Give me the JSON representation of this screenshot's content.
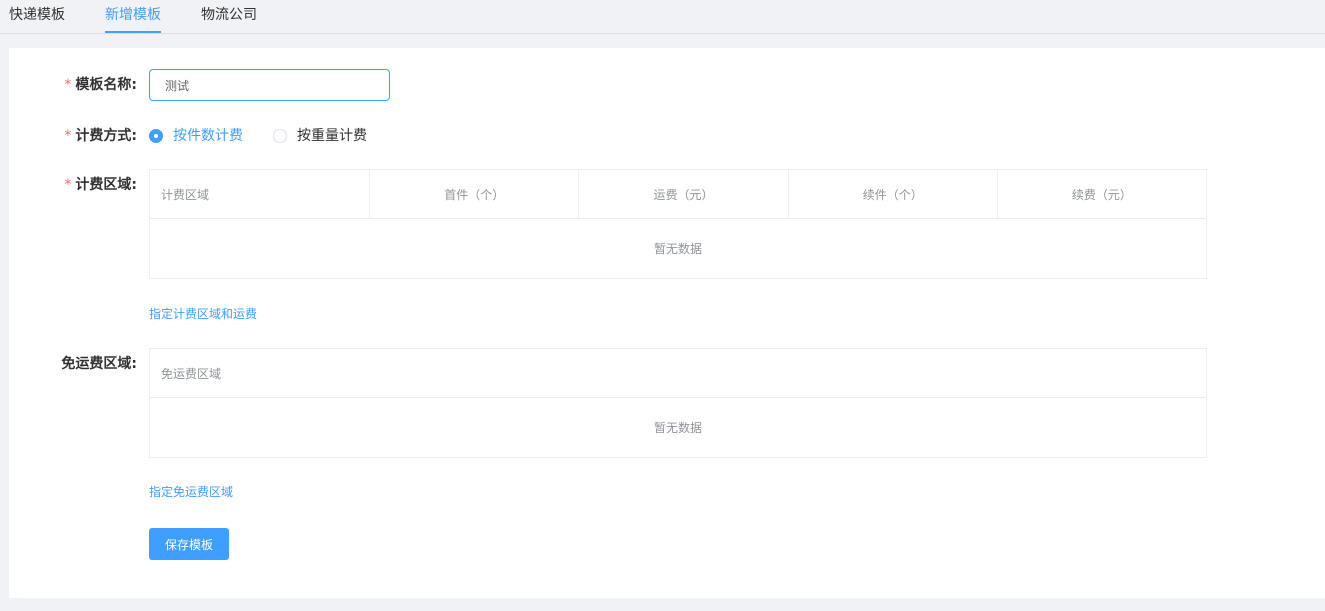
{
  "tabs": [
    {
      "label": "快递模板",
      "active": false
    },
    {
      "label": "新增模板",
      "active": true
    },
    {
      "label": "物流公司",
      "active": false
    }
  ],
  "form": {
    "required_mark": "*",
    "name_label": "模板名称:",
    "name_value": "测试",
    "method_label": "计费方式:",
    "method_options": [
      {
        "label": "按件数计费",
        "checked": true
      },
      {
        "label": "按重量计费",
        "checked": false
      }
    ],
    "area_label": "计费区域:",
    "area_table": {
      "columns": [
        "计费区域",
        "首件（个）",
        "运费（元）",
        "续件（个）",
        "续费（元）"
      ],
      "empty_text": "暂无数据"
    },
    "area_link": "指定计费区域和运费",
    "free_label": "免运费区域:",
    "free_table": {
      "columns": [
        "免运费区域"
      ],
      "empty_text": "暂无数据"
    },
    "free_link": "指定免运费区域",
    "save_label": "保存模板"
  },
  "colors": {
    "accent": "#409eff",
    "required": "#f56c6c",
    "background": "#f0f2f5"
  }
}
